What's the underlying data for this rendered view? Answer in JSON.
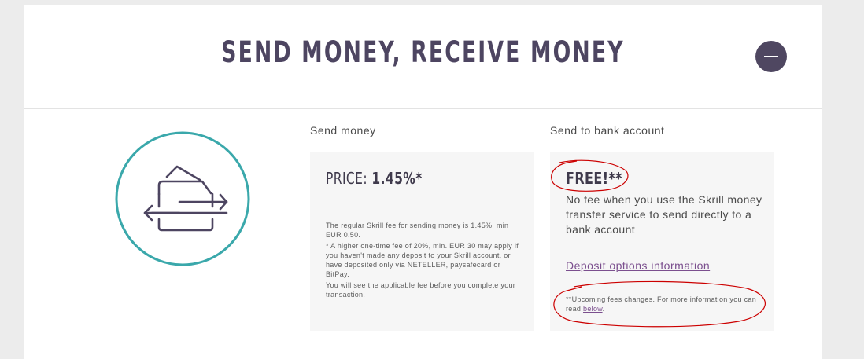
{
  "section": {
    "title": "SEND MONEY, RECEIVE MONEY",
    "collapse_icon": "minus-icon"
  },
  "illustration": {
    "icon": "wallet-transfer-arrows-icon",
    "ring_color": "#3aa8ab",
    "stroke_color": "#4d4561"
  },
  "send_money": {
    "label": "Send money",
    "price_label": "PRICE:",
    "price_value": "1.45%*",
    "notes": [
      "The regular Skrill fee for sending money is 1.45%, min EUR 0.50.",
      "* A higher one-time fee of 20%, min. EUR 30 may apply if you haven't made any deposit to your Skrill account, or have deposited only via NETELLER, paysafecard or BitPay.",
      "You will see the applicable fee before you complete your transaction."
    ]
  },
  "bank_account": {
    "label": "Send to bank account",
    "free_text": "FREE!**",
    "description": "No fee when you use the Skrill money transfer service to send directly to a bank account",
    "deposit_link": "Deposit options information",
    "upcoming_text": "**Upcoming fees changes. For more information you can read",
    "below_link": "below",
    "upcoming_end": "."
  },
  "colors": {
    "title": "#4d4561",
    "button": "#4f4761",
    "link": "#7b4f8e",
    "annotation": "#cc0000"
  }
}
